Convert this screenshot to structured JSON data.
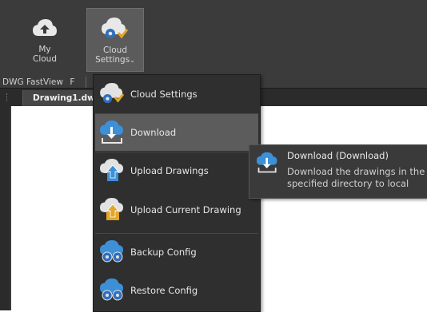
{
  "ribbon": {
    "my_cloud_label": "My\nCloud",
    "cloud_settings_label": "Cloud\nSettings",
    "panel_label": "DWG FastView",
    "panel_label_2": "F"
  },
  "tabs": {
    "drawing_tab": "Drawing1.dw"
  },
  "menu": {
    "items": [
      {
        "label": "Cloud Settings"
      },
      {
        "label": "Download"
      },
      {
        "label": "Upload Drawings"
      },
      {
        "label": "Upload Current Drawing"
      },
      {
        "label": "Backup Config"
      },
      {
        "label": "Restore Config"
      }
    ]
  },
  "tooltip": {
    "title": "Download (Download)",
    "description_line1": "Download the drawings in the",
    "description_line2": "specified directory to local"
  },
  "colors": {
    "ribbon_bg": "#3b3b3b",
    "menu_bg": "#2f2f2f",
    "highlight": "#5c5c5c",
    "cloud_blue": "#3d8fd6",
    "gear_blue": "#2f6fbd"
  }
}
